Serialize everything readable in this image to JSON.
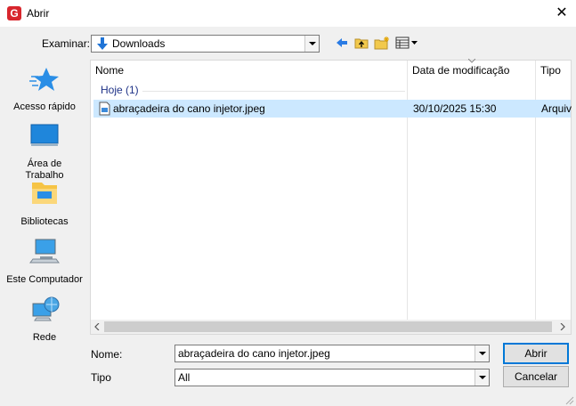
{
  "window": {
    "title": "Abrir",
    "app_icon_letter": "G"
  },
  "toolbar": {
    "lookin_label": "Examinar:",
    "lookin_value": "Downloads"
  },
  "sidebar": {
    "items": [
      {
        "label": "Acesso rápido",
        "icon": "star-icon"
      },
      {
        "label": "Área de Trabalho",
        "icon": "desktop-icon"
      },
      {
        "label": "Bibliotecas",
        "icon": "libraries-icon"
      },
      {
        "label": "Este Computador",
        "icon": "computer-icon"
      },
      {
        "label": "Rede",
        "icon": "network-icon"
      }
    ]
  },
  "list": {
    "columns": [
      "Nome",
      "Data de modificação",
      "Tipo"
    ],
    "group": "Hoje (1)",
    "rows": [
      {
        "name": "abraçadeira do cano injetor.jpeg",
        "date": "30/10/2025 15:30",
        "type": "Arquiv"
      }
    ]
  },
  "footer": {
    "name_label": "Nome:",
    "name_value": "abraçadeira do cano injetor.jpeg",
    "type_label": "Tipo",
    "type_value": "All",
    "open_button": "Abrir",
    "cancel_button": "Cancelar"
  },
  "colors": {
    "selection": "#cce8ff",
    "group_text": "#1e3287",
    "default_button_border": "#0078d7"
  }
}
